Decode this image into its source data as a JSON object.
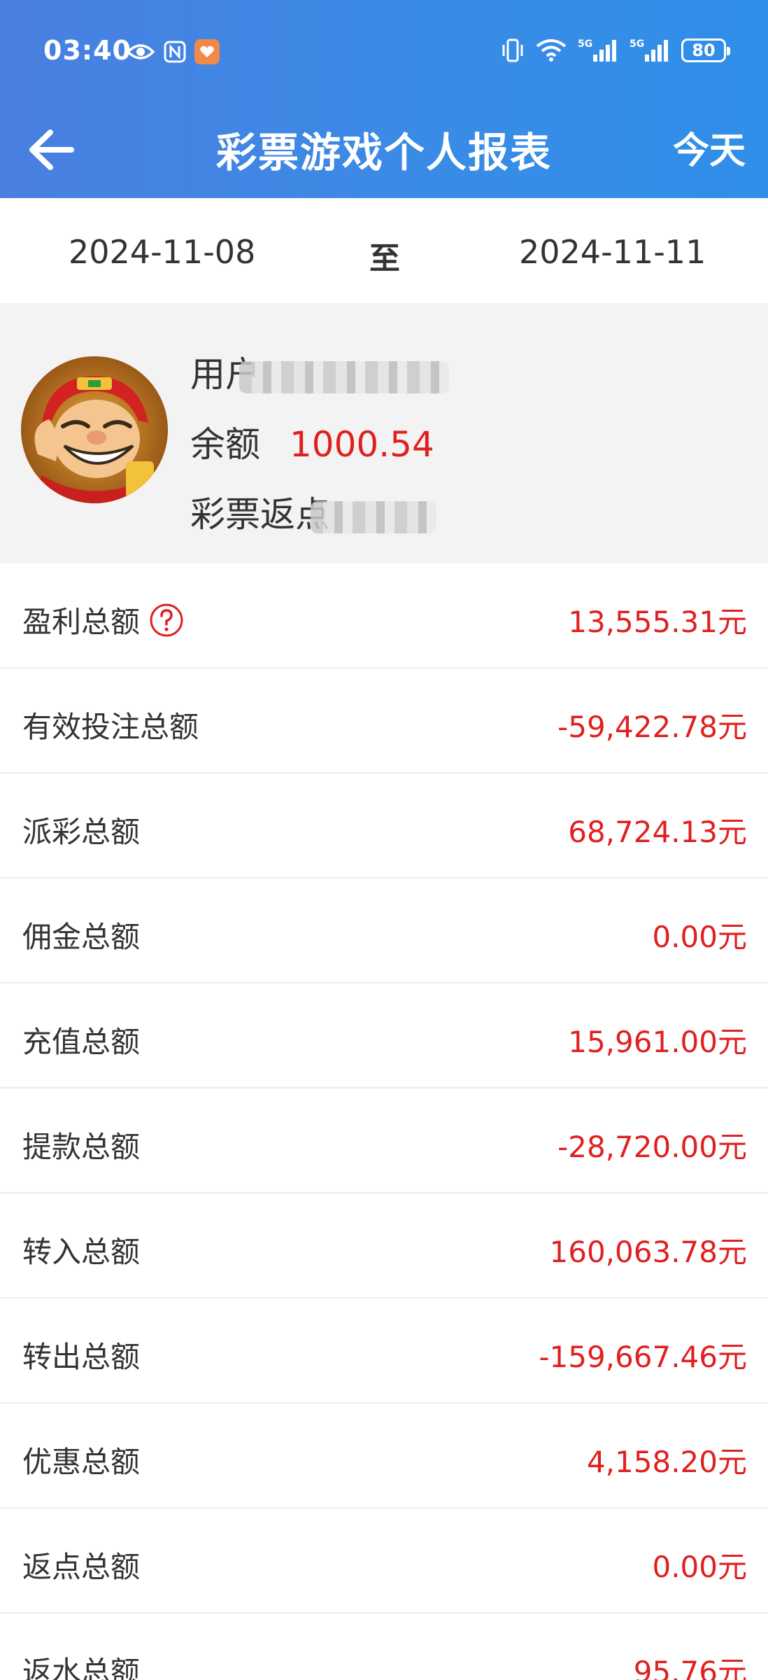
{
  "status_bar": {
    "time": "03:40",
    "battery": "80",
    "icons": [
      "eye-icon",
      "nfc-icon",
      "app-badge-icon",
      "vibrate-icon",
      "wifi-icon",
      "signal-5g-icon",
      "signal-5g-icon",
      "battery-icon"
    ]
  },
  "nav": {
    "title": "彩票游戏个人报表",
    "today_label": "今天",
    "back_icon": "arrow-left-icon"
  },
  "date_range": {
    "start": "2024-11-08",
    "separator": "至",
    "end": "2024-11-11"
  },
  "profile": {
    "username_label": "用户",
    "balance_label": "余额",
    "balance_value": "1000.54",
    "rebate_label": "彩票返点"
  },
  "rows": [
    {
      "label": "盈利总额",
      "value": "13,555.31元",
      "has_help": true
    },
    {
      "label": "有效投注总额",
      "value": "-59,422.78元"
    },
    {
      "label": "派彩总额",
      "value": "68,724.13元"
    },
    {
      "label": "佣金总额",
      "value": "0.00元"
    },
    {
      "label": "充值总额",
      "value": "15,961.00元"
    },
    {
      "label": "提款总额",
      "value": "-28,720.00元"
    },
    {
      "label": "转入总额",
      "value": "160,063.78元"
    },
    {
      "label": "转出总额",
      "value": "-159,667.46元"
    },
    {
      "label": "优惠总额",
      "value": "4,158.20元"
    },
    {
      "label": "返点总额",
      "value": "0.00元"
    },
    {
      "label": "返水总额",
      "value": "95.76元"
    }
  ],
  "colors": {
    "header_start": "#4a7fe0",
    "header_end": "#2f8fe8",
    "value_red": "#e02020",
    "profile_bg": "#f3f3f3"
  }
}
